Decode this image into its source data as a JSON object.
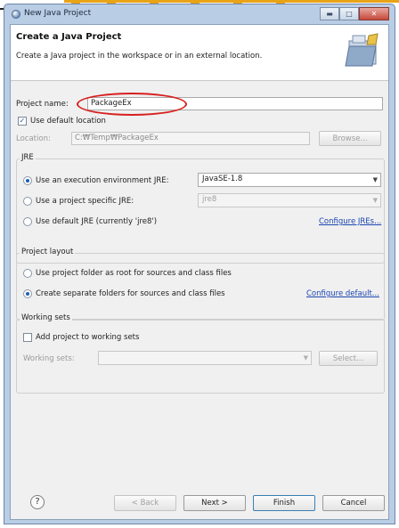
{
  "window": {
    "title": "New Java Project"
  },
  "header": {
    "title": "Create a Java Project",
    "description": "Create a Java project in the workspace or in an external location."
  },
  "project": {
    "name_label": "Project name:",
    "name_value": "PackageEx",
    "use_default_label": "Use default location",
    "use_default_checked": true,
    "location_label": "Location:",
    "location_value": "C:₩Temp₩PackageEx",
    "browse_label": "Browse..."
  },
  "jre": {
    "group_title": "JRE",
    "env_label": "Use an execution environment JRE:",
    "env_value": "JavaSE-1.8",
    "specific_label": "Use a project specific JRE:",
    "specific_value": "jre8",
    "default_label": "Use default JRE (currently 'jre8')",
    "configure_link": "Configure JREs..."
  },
  "layout": {
    "group_title": "Project layout",
    "root_label": "Use project folder as root for sources and class files",
    "separate_label": "Create separate folders for sources and class files",
    "configure_link": "Configure default..."
  },
  "working_sets": {
    "group_title": "Working sets",
    "add_label": "Add project to working sets",
    "sets_label": "Working sets:",
    "select_label": "Select..."
  },
  "footer": {
    "help": "?",
    "back": "< Back",
    "next": "Next >",
    "finish": "Finish",
    "cancel": "Cancel"
  },
  "icons": {
    "title_icon": "eclipse-icon",
    "header_icon": "folder-wizard-icon",
    "help_icon": "help-icon",
    "dropdown_icon": "chevron-down-icon"
  },
  "colors": {
    "window_frame": "#b9cde5",
    "annotation": "#d81f1f",
    "link": "#1a45b0",
    "top_strip": "#e8a317"
  }
}
